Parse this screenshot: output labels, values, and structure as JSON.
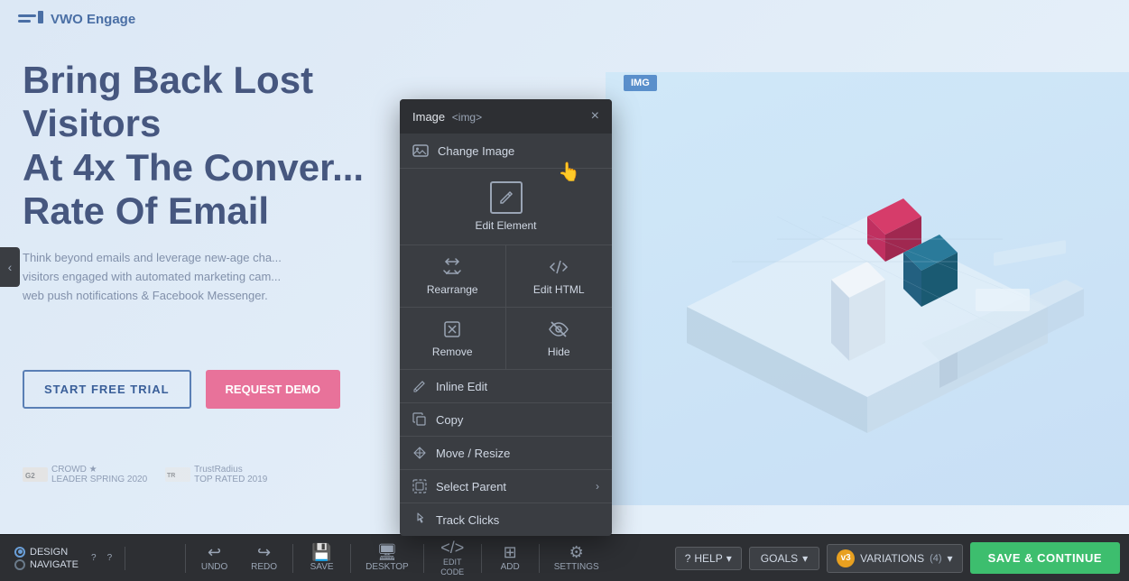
{
  "app": {
    "name": "VWO Engage"
  },
  "hero": {
    "title": "Bring Back Lost Visitors\nAt 4x The Conver...\nRate Of Email",
    "subtitle": "Think beyond emails and leverage new-age cha...\nvisitors engaged with automated marketing cam...\nweb push notifications & Facebook Messenger.",
    "btn_trial": "START FREE TRIAL",
    "btn_demo": "REQUEST DEMO"
  },
  "img_badge": "IMG",
  "context_menu": {
    "title": "Image",
    "title_tag": "<img>",
    "close_label": "×",
    "items": [
      {
        "id": "change-image",
        "label": "Change Image",
        "icon": "image"
      },
      {
        "id": "edit-element",
        "label": "Edit Element",
        "icon": "edit",
        "big": true
      },
      {
        "id": "rearrange",
        "label": "Rearrange",
        "icon": "rearrange"
      },
      {
        "id": "edit-html",
        "label": "Edit HTML",
        "icon": "code"
      },
      {
        "id": "remove",
        "label": "Remove",
        "icon": "x"
      },
      {
        "id": "hide",
        "label": "Hide",
        "icon": "eye"
      },
      {
        "id": "inline-edit",
        "label": "Inline Edit",
        "icon": "cursor"
      },
      {
        "id": "copy",
        "label": "Copy",
        "icon": "copy"
      },
      {
        "id": "move-resize",
        "label": "Move / Resize",
        "icon": "move"
      },
      {
        "id": "select-parent",
        "label": "Select Parent",
        "icon": "parent",
        "arrow": true
      },
      {
        "id": "track-clicks",
        "label": "Track Clicks",
        "icon": "mouse"
      }
    ]
  },
  "toolbar": {
    "design_label": "DESIGN",
    "navigate_label": "NAVIGATE",
    "undo_label": "UNDO",
    "redo_label": "REDO",
    "save_label": "SAVE",
    "desktop_label": "DESKTOP",
    "edit_code_label": "EDIT\nCODE",
    "add_label": "ADD",
    "settings_label": "SETTINGS",
    "help_label": "HELP",
    "goals_label": "GOALS",
    "variations_label": "VARIATIONS",
    "variations_count": "(4)",
    "v3_label": "v3",
    "save_continue_label": "SAVE & CONTINUE"
  }
}
